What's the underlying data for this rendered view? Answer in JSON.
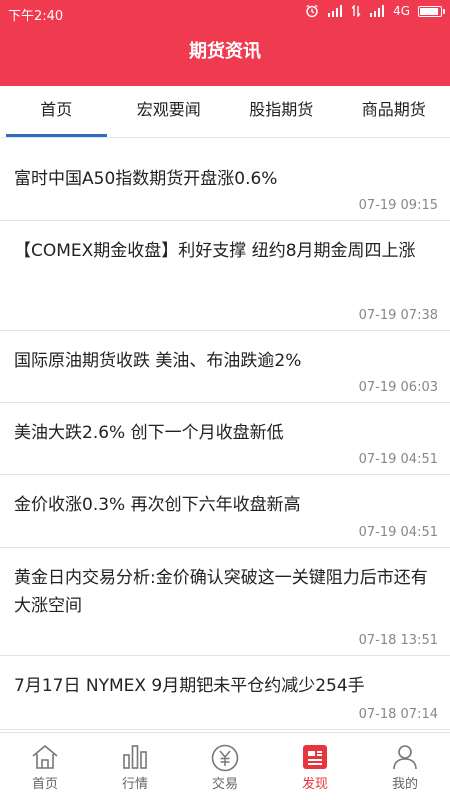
{
  "status_bar": {
    "time": "下午2:40",
    "network": "4G"
  },
  "header": {
    "title": "期货资讯"
  },
  "tabs": [
    {
      "label": "首页",
      "active": true
    },
    {
      "label": "宏观要闻",
      "active": false
    },
    {
      "label": "股指期货",
      "active": false
    },
    {
      "label": "商品期货",
      "active": false
    }
  ],
  "news": [
    {
      "title": "富时中国A50指数期货开盘涨0.6%",
      "time": "07-19 09:15"
    },
    {
      "title": "【COMEX期金收盘】利好支撑 纽约8月期金周四上涨",
      "time": "07-19 07:38"
    },
    {
      "title": "国际原油期货收跌 美油、布油跌逾2%",
      "time": "07-19 06:03"
    },
    {
      "title": "美油大跌2.6% 创下一个月收盘新低",
      "time": "07-19 04:51"
    },
    {
      "title": "金价收涨0.3% 再次创下六年收盘新高",
      "time": "07-19 04:51"
    },
    {
      "title": "黄金日内交易分析:金价确认突破这一关键阻力后市还有大涨空间",
      "time": "07-18 13:51"
    },
    {
      "title": "7月17日 NYMEX 9月期钯未平仓约减少254手",
      "time": "07-18 07:14"
    }
  ],
  "bottom_nav": [
    {
      "label": "首页",
      "icon": "home-icon",
      "active": false
    },
    {
      "label": "行情",
      "icon": "bar-chart-icon",
      "active": false
    },
    {
      "label": "交易",
      "icon": "yen-coin-icon",
      "active": false
    },
    {
      "label": "发现",
      "icon": "discover-icon",
      "active": true
    },
    {
      "label": "我的",
      "icon": "user-icon",
      "active": false
    }
  ],
  "colors": {
    "header_red": "#ef3a4f",
    "tab_indicator_blue": "#2f6dc0",
    "nav_active_red": "#e8343d"
  }
}
